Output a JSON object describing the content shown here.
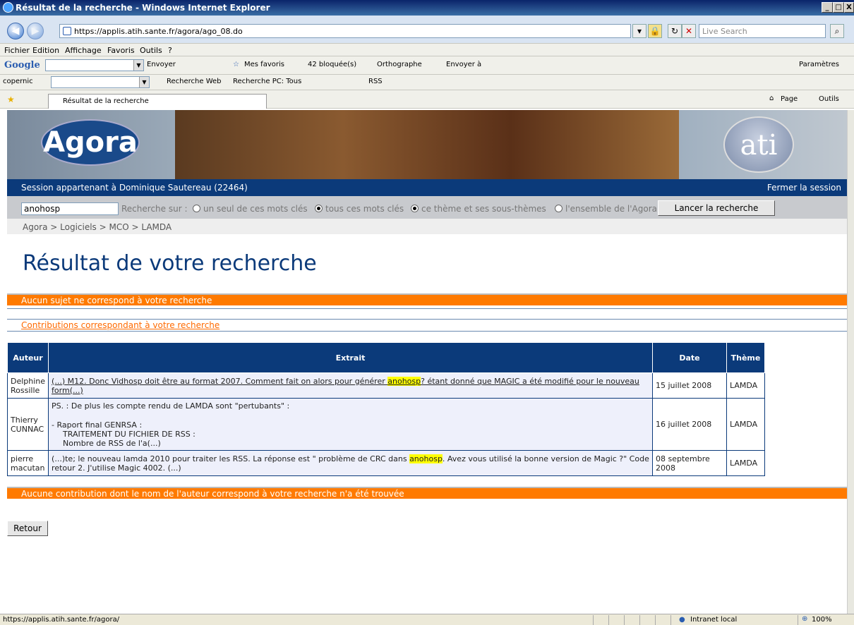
{
  "window": {
    "title": "Résultat de la recherche - Windows Internet Explorer",
    "min": "_",
    "max": "□",
    "close": "X"
  },
  "address_bar": {
    "url": "https://applis.atih.sante.fr/agora/ago_08.do",
    "search_placeholder": "Live Search"
  },
  "menu": {
    "items": [
      "Fichier",
      "Edition",
      "Affichage",
      "Favoris",
      "Outils",
      "?"
    ],
    "params": "Paramètres"
  },
  "google_toolbar": {
    "logo": "Google",
    "envoyer": "Envoyer",
    "mes_favoris": "Mes favoris",
    "bloquees": "42 bloquée(s)",
    "orthographe": "Orthographe",
    "envoyer_a": "Envoyer à"
  },
  "copernic_toolbar": {
    "label": "copernic",
    "recherche_web": "Recherche Web",
    "recherche_pc": "Recherche PC: Tous",
    "rss": "RSS"
  },
  "tab": {
    "label": "Résultat de la recherche",
    "page": "Page",
    "outils": "Outils"
  },
  "banner": {
    "logo": "Agora",
    "logo2": "ati"
  },
  "session": {
    "text": "Session appartenant à Dominique Sautereau (22464)",
    "logout": "Fermer la session"
  },
  "search": {
    "value": "anohosp",
    "label": "Recherche sur :",
    "opt1": "un seul de ces mots clés",
    "opt2": "tous ces mots clés",
    "opt3": "ce thème et ses sous-thèmes",
    "opt4": "l'ensemble de l'Agora",
    "button": "Lancer la recherche"
  },
  "breadcrumb": "Agora > Logiciels > MCO > LAMDA",
  "page_title": "Résultat de votre recherche",
  "no_subject": "Aucun sujet ne correspond à votre recherche",
  "contributions_header": "Contributions correspondant à votre recherche",
  "table": {
    "headers": {
      "auteur": "Auteur",
      "extrait": "Extrait",
      "date": "Date",
      "theme": "Thème"
    },
    "rows": [
      {
        "auteur": "Delphine Rossille",
        "pre": "(...) M12. Donc Vidhosp doit être au format 2007. Comment fait on alors pour générer ",
        "hl": "anohosp",
        "post": "? étant donné que MAGIC a été modifié pour le nouveau form(...)",
        "date": "15 juillet 2008",
        "theme": "LAMDA"
      },
      {
        "auteur": "Thierry CUNNAC",
        "line1": "PS. : De plus les compte rendu de LAMDA sont \"pertubants\" :",
        "line2": "- Raport final GENRSA :",
        "line3": "TRAITEMENT DU FICHIER DE RSS :",
        "line4": "Nombre de RSS de l'a(...)",
        "date": "16 juillet 2008",
        "theme": "LAMDA"
      },
      {
        "auteur": "pierre macutan",
        "pre": "(...)te; le nouveau lamda 2010 pour traiter les RSS. La réponse est \" problème de CRC dans ",
        "hl": "anohosp",
        "post": ". Avez vous utilisé la bonne version de Magic ?\" Code retour 2. J'utilise Magic 4002. (...)",
        "date": "08 septembre 2008",
        "theme": "LAMDA"
      }
    ]
  },
  "no_author": "Aucune contribution dont le nom de l'auteur correspond à votre recherche n'a été trouvée",
  "retour": "Retour",
  "status": {
    "url": "https://applis.atih.sante.fr/agora/",
    "zone": "Intranet local",
    "zoom": "100%"
  },
  "colors": {
    "navy": "#0b3a7a",
    "orange": "#ff7a00",
    "highlight": "#ffff00"
  }
}
